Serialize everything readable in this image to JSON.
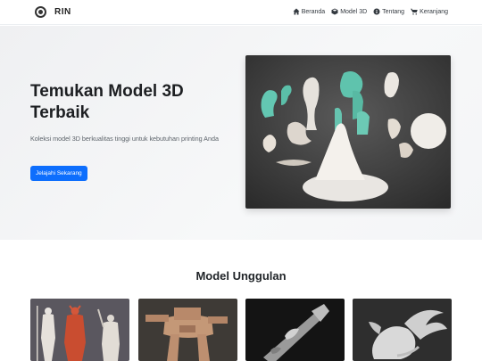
{
  "brand": {
    "name": "RIN",
    "icon": "logo-icon"
  },
  "nav": {
    "items": [
      {
        "label": "Beranda",
        "icon": "home-icon"
      },
      {
        "label": "Model 3D",
        "icon": "cube-icon"
      },
      {
        "label": "Tentang",
        "icon": "info-icon"
      },
      {
        "label": "Keranjang",
        "icon": "cart-icon"
      }
    ]
  },
  "hero": {
    "title": "Temukan Model 3D Terbaik",
    "subtitle": "Koleksi model 3D berkualitas tinggi untuk kebutuhan printing Anda",
    "cta_label": "Jelajahi Sekarang"
  },
  "featured": {
    "title": "Model Unggulan"
  },
  "colors": {
    "primary": "#0d6efd",
    "hero_bg": "#f2f3f5",
    "text": "#212529"
  }
}
